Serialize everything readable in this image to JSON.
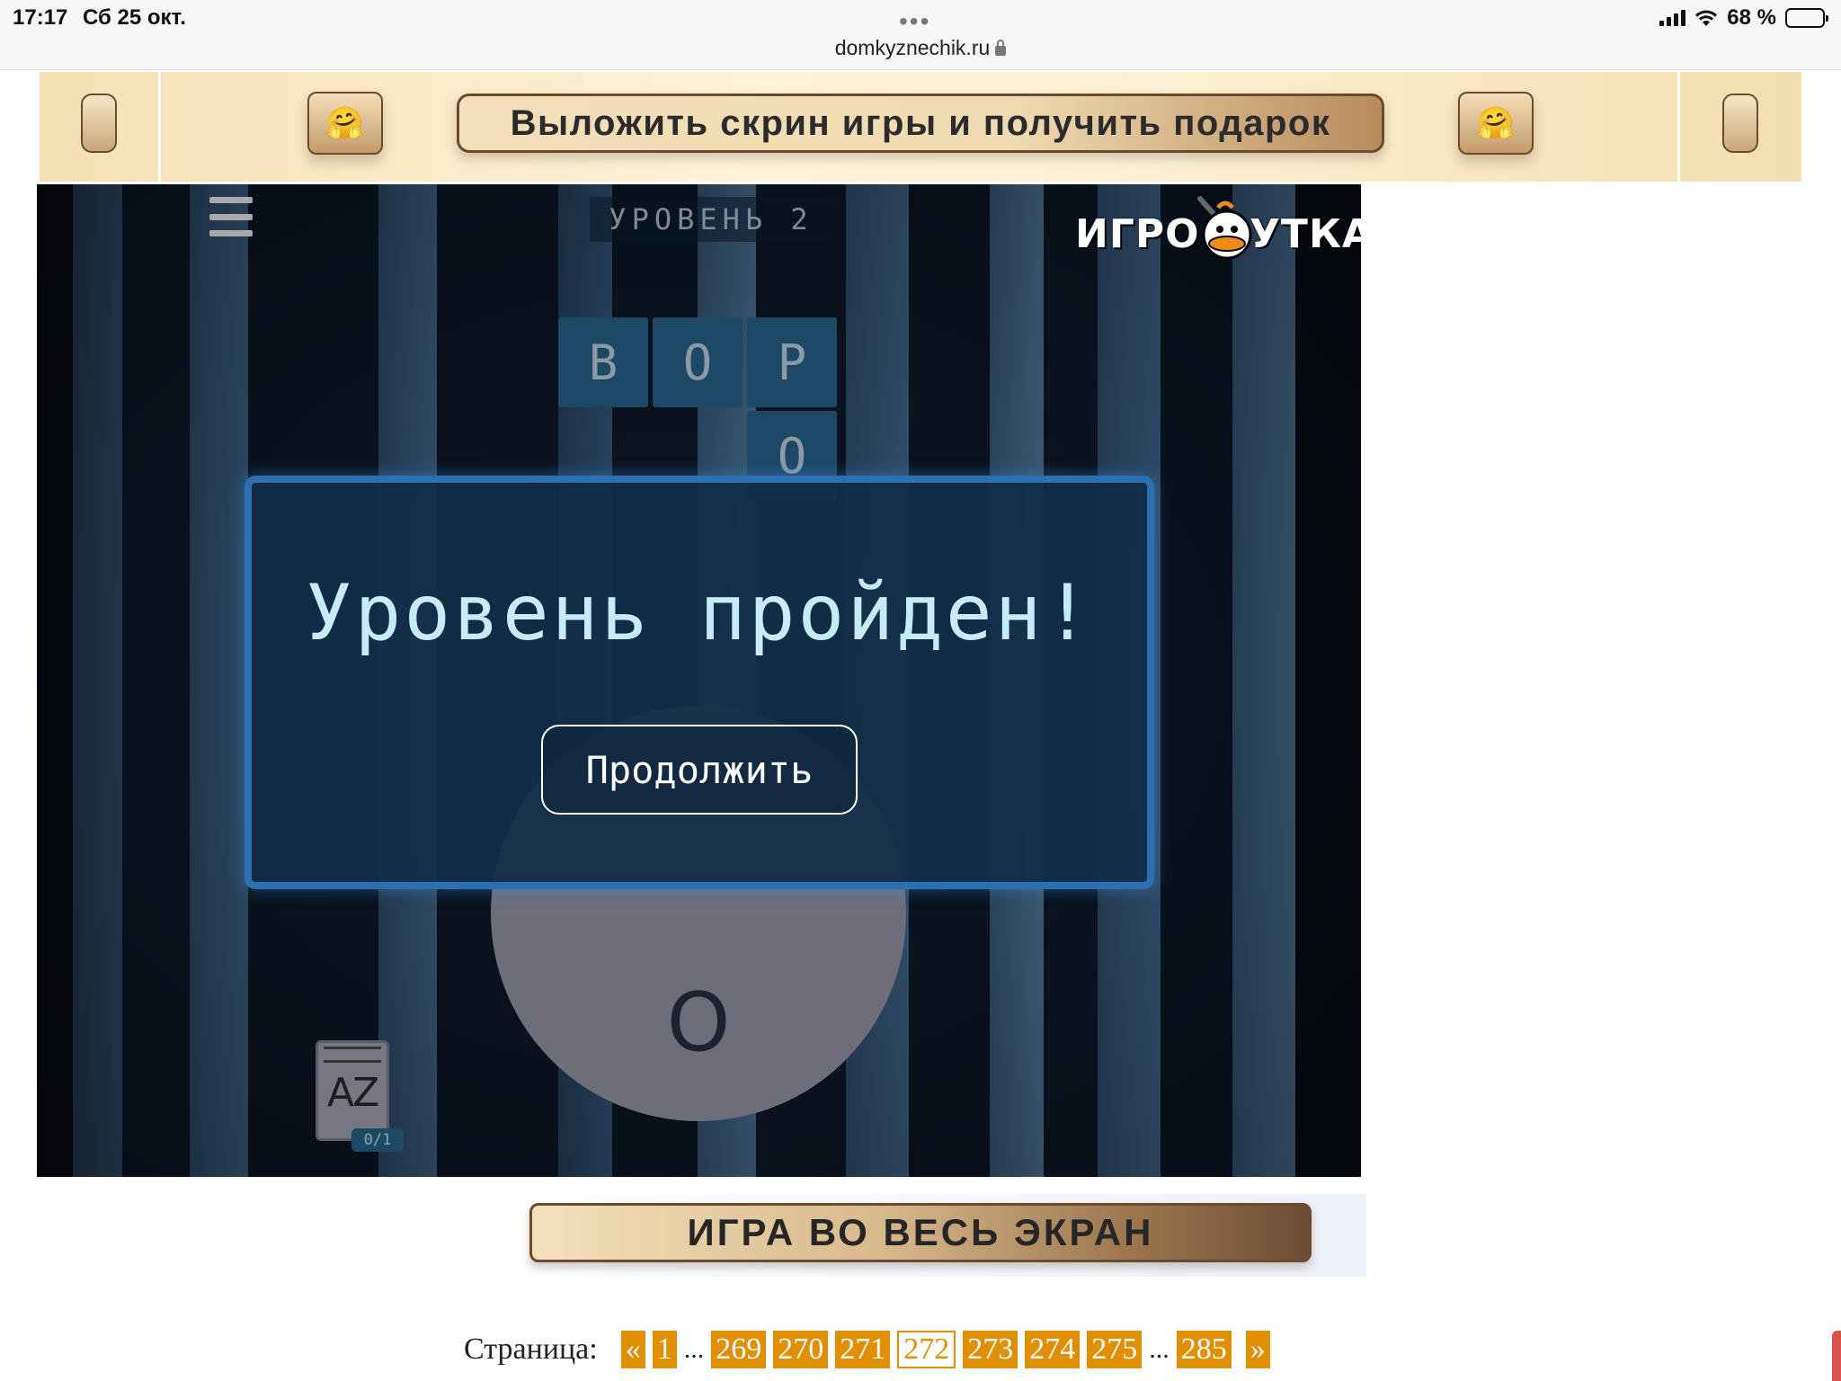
{
  "status_bar": {
    "time": "17:17",
    "date": "Сб 25 окт.",
    "url": "domkyznechik.ru",
    "battery": "68 %"
  },
  "promo": {
    "label": "Выложить скрин игры и получить подарок",
    "emoji": "🤗"
  },
  "game": {
    "level_label": "УРОВЕНЬ 2",
    "logo_left": "ИГРО",
    "logo_right": "УТКА",
    "tiles": [
      "В",
      "О",
      "Р",
      "О"
    ],
    "wheel_letter": "О",
    "dict_icon_text": "AZ",
    "dict_count": "0/1",
    "modal": {
      "title": "Уровень пройден!",
      "continue_label": "Продолжить"
    }
  },
  "fullscreen_label": "ИГРА ВО ВЕСЬ ЭКРАН",
  "pagination": {
    "label": "Страница:",
    "prev": "«",
    "next": "»",
    "dots": "...",
    "pages": [
      "1",
      "269",
      "270",
      "271",
      "272",
      "273",
      "274",
      "275",
      "285"
    ],
    "current": "272"
  },
  "colors": {
    "accent_orange": "#e08f00",
    "modal_border": "#2d70b2",
    "modal_title": "#c6ecfb",
    "promo_gold": "#f3dfb8"
  }
}
